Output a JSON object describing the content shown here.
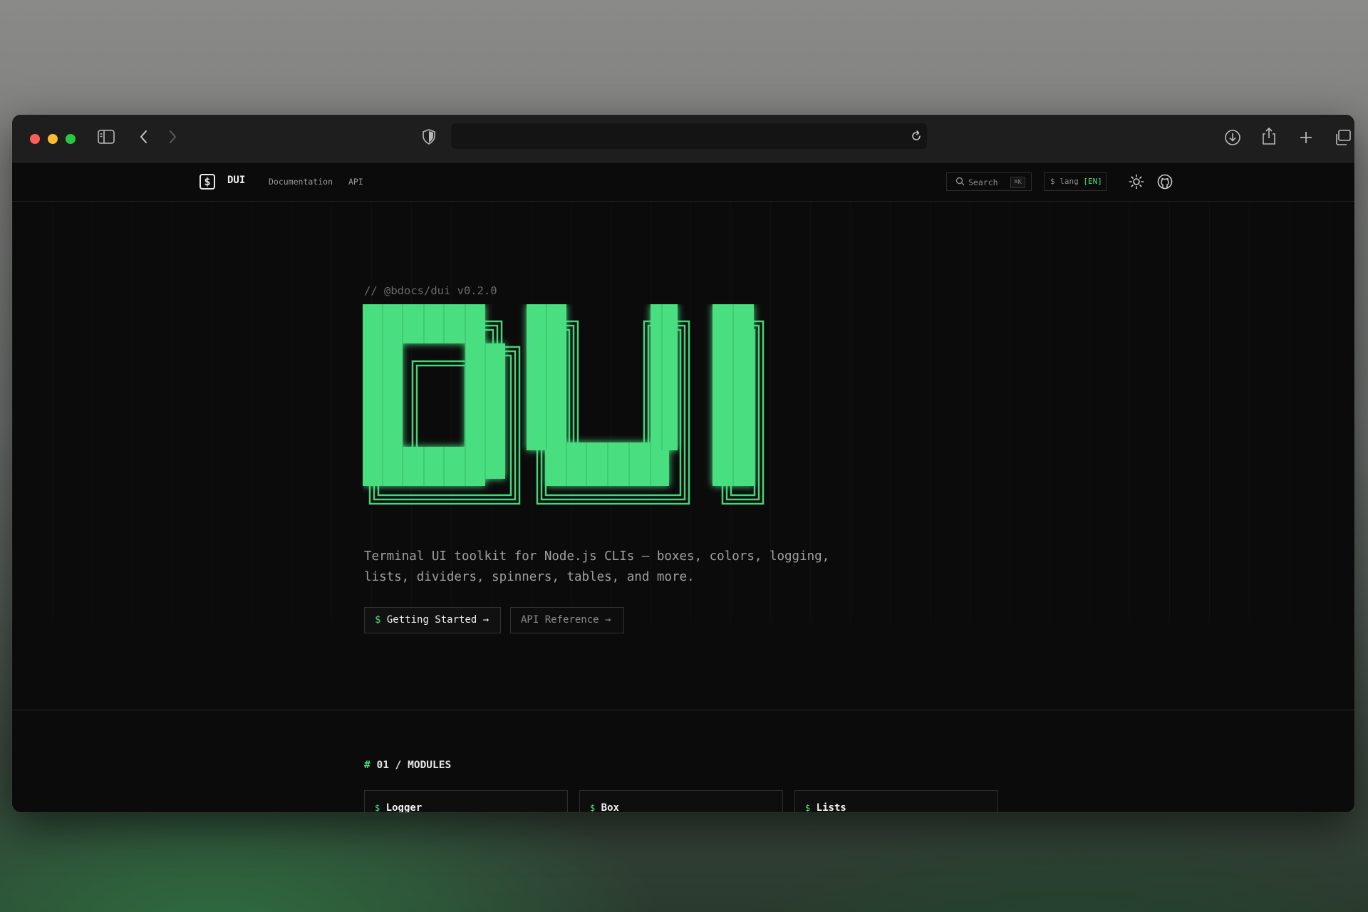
{
  "browser": {
    "url": "",
    "colors": {
      "close": "#ff5f57",
      "minimize": "#febc2e",
      "maximize": "#28c840"
    },
    "icons": [
      "sidebar-icon",
      "back-icon",
      "forward-icon",
      "shield-icon",
      "reload-icon",
      "download-icon",
      "share-icon",
      "new-tab-icon",
      "tabs-overview-icon"
    ]
  },
  "nav": {
    "logo_glyph": "$",
    "brand": "DUI",
    "links": [
      "Documentation",
      "API"
    ],
    "search_label": "Search",
    "search_shortcut": "⌘K",
    "lang_prefix": "$ lang",
    "lang_value": "[EN]"
  },
  "hero": {
    "version": "// @bdocs/dui v0.2.0",
    "title_art": "DUI",
    "accent_color": "#4ade80",
    "tagline": "Terminal UI toolkit for Node.js CLIs — boxes, colors, logging, lists, dividers, spinners, tables, and more.",
    "primary_button": {
      "prefix": "$",
      "label": "Getting Started →"
    },
    "secondary_button": {
      "label": "API Reference →"
    }
  },
  "modules": {
    "hash": "#",
    "title": "01 / MODULES",
    "cards": [
      {
        "prefix": "$",
        "label": "Logger"
      },
      {
        "prefix": "$",
        "label": "Box"
      },
      {
        "prefix": "$",
        "label": "Lists"
      }
    ]
  }
}
